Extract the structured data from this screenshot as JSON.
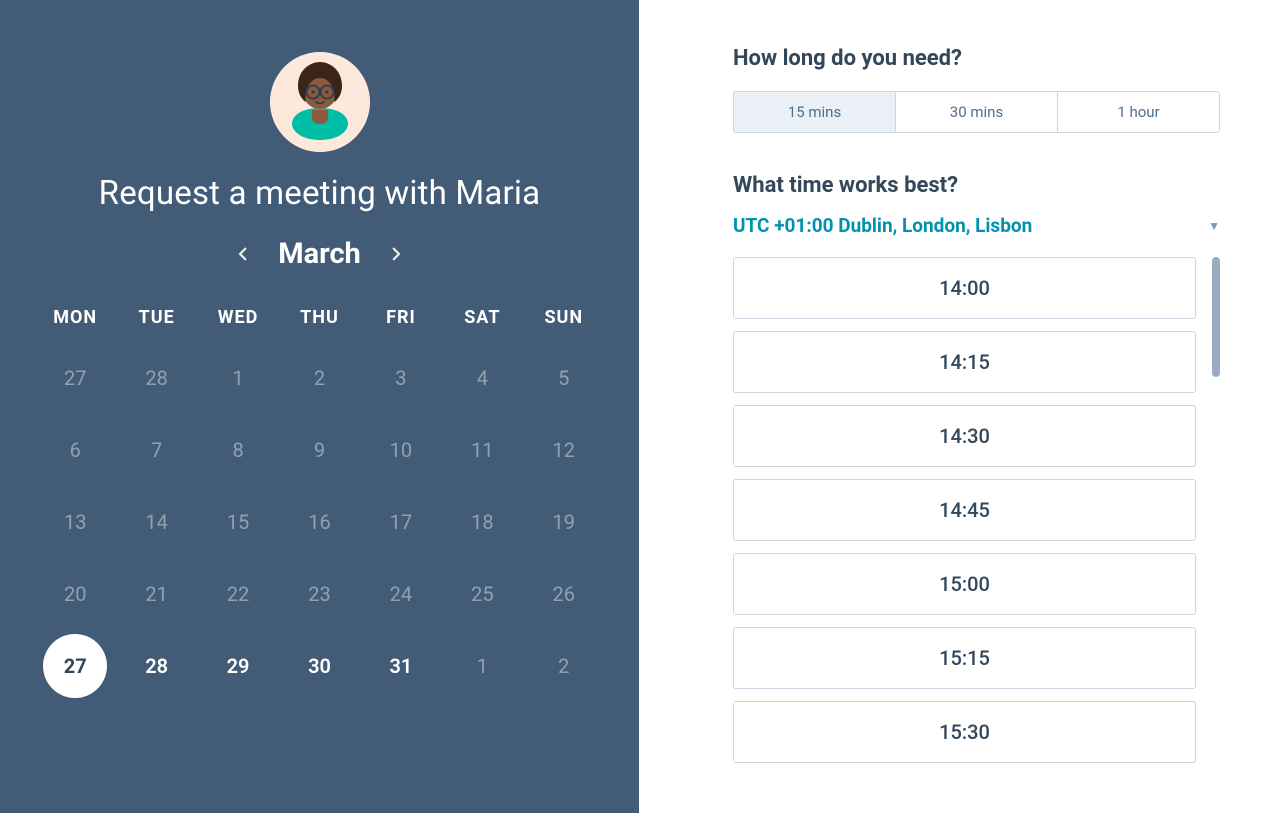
{
  "left": {
    "title": "Request a meeting with Maria",
    "month": "March",
    "weekdays": [
      "MON",
      "TUE",
      "WED",
      "THU",
      "FRI",
      "SAT",
      "SUN"
    ],
    "weeks": [
      [
        {
          "n": "27",
          "dim": true
        },
        {
          "n": "28",
          "dim": true
        },
        {
          "n": "1",
          "dim": true
        },
        {
          "n": "2",
          "dim": true
        },
        {
          "n": "3",
          "dim": true
        },
        {
          "n": "4",
          "dim": true
        },
        {
          "n": "5",
          "dim": true
        }
      ],
      [
        {
          "n": "6",
          "dim": true
        },
        {
          "n": "7",
          "dim": true
        },
        {
          "n": "8",
          "dim": true
        },
        {
          "n": "9",
          "dim": true
        },
        {
          "n": "10",
          "dim": true
        },
        {
          "n": "11",
          "dim": true
        },
        {
          "n": "12",
          "dim": true
        }
      ],
      [
        {
          "n": "13",
          "dim": true
        },
        {
          "n": "14",
          "dim": true
        },
        {
          "n": "15",
          "dim": true
        },
        {
          "n": "16",
          "dim": true
        },
        {
          "n": "17",
          "dim": true
        },
        {
          "n": "18",
          "dim": true
        },
        {
          "n": "19",
          "dim": true
        }
      ],
      [
        {
          "n": "20",
          "dim": true
        },
        {
          "n": "21",
          "dim": true
        },
        {
          "n": "22",
          "dim": true
        },
        {
          "n": "23",
          "dim": true
        },
        {
          "n": "24",
          "dim": true
        },
        {
          "n": "25",
          "dim": true
        },
        {
          "n": "26",
          "dim": true
        }
      ],
      [
        {
          "n": "27",
          "dim": false,
          "selected": true
        },
        {
          "n": "28",
          "dim": false
        },
        {
          "n": "29",
          "dim": false
        },
        {
          "n": "30",
          "dim": false
        },
        {
          "n": "31",
          "dim": false
        },
        {
          "n": "1",
          "dim": true
        },
        {
          "n": "2",
          "dim": true
        }
      ]
    ]
  },
  "right": {
    "duration_heading": "How long do you need?",
    "durations": [
      {
        "label": "15 mins",
        "active": true
      },
      {
        "label": "30 mins",
        "active": false
      },
      {
        "label": "1 hour",
        "active": false
      }
    ],
    "time_heading": "What time works best?",
    "timezone": "UTC +01:00 Dublin, London, Lisbon",
    "slots": [
      "14:00",
      "14:15",
      "14:30",
      "14:45",
      "15:00",
      "15:15",
      "15:30"
    ]
  }
}
